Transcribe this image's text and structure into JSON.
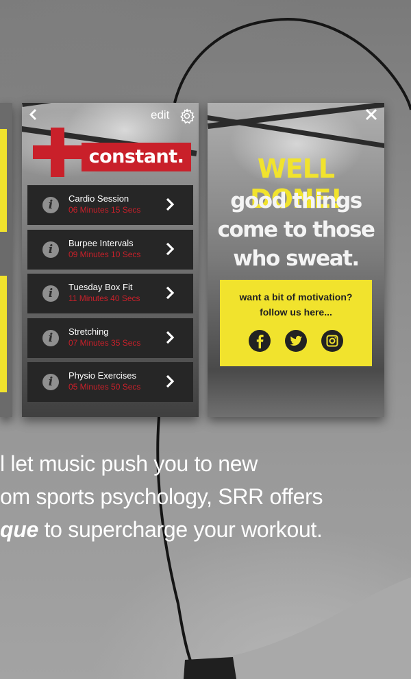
{
  "colors": {
    "brand_red": "#c9202a",
    "accent_yellow": "#f1e32d",
    "dark_row": "#262626",
    "text_white": "#ffffff"
  },
  "middle_panel": {
    "back_icon": "chevron-left-icon",
    "edit_label": "edit",
    "settings_icon": "gear-icon",
    "logo_text": "constant.",
    "workouts": [
      {
        "title": "Cardio Session",
        "duration": "06 Minutes 15 Secs"
      },
      {
        "title": "Burpee Intervals",
        "duration": "09 Minutes 10 Secs"
      },
      {
        "title": "Tuesday Box Fit",
        "duration": "11 Minutes 40 Secs"
      },
      {
        "title": "Stretching",
        "duration": "07 Minutes 35 Secs"
      },
      {
        "title": "Physio Exercises",
        "duration": "05 Minutes 50 Secs"
      }
    ]
  },
  "right_panel": {
    "close_icon": "close-icon",
    "headline": "WELL DONE!",
    "message_line1": "good things",
    "message_line2": "come to those",
    "message_line3": "who sweat.",
    "motivation_line1": "want a bit of motivation?",
    "motivation_line2": "follow us here...",
    "social_icons": [
      "facebook-icon",
      "twitter-icon",
      "instagram-icon"
    ]
  },
  "marketing": {
    "line1": "l let music push you to new",
    "line2": "om sports psychology, SRR offers",
    "line3_emphasis": "que",
    "line3_rest": " to supercharge your workout."
  }
}
